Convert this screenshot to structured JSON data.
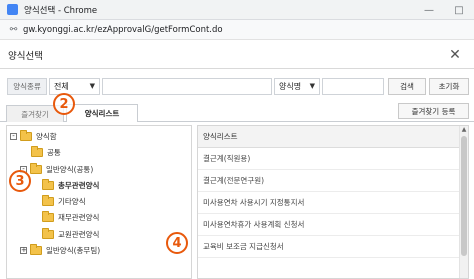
{
  "window": {
    "title": "양식선택 - Chrome",
    "url": "gw.kyonggi.ac.kr/ezApprovalG/getFormCont.do"
  },
  "dialog": {
    "title": "양식선택"
  },
  "search": {
    "form_type_label": "양식종류",
    "form_type_value": "전체",
    "form_name_label": "양식명",
    "form_name_value": "",
    "search_button": "검색",
    "reset_button": "초기화"
  },
  "tabs": [
    {
      "label": "즐겨찾기"
    },
    {
      "label": "양식리스트"
    }
  ],
  "favorite_button": "즐겨찾기 등록",
  "tree": [
    {
      "label": "양식함",
      "expander": "-"
    },
    {
      "label": "공통",
      "expander": ""
    },
    {
      "label": "일반양식(공통)",
      "expander": "-"
    },
    {
      "label": "총무관련양식",
      "expander": ""
    },
    {
      "label": "기타양식",
      "expander": ""
    },
    {
      "label": "재무관련양식",
      "expander": ""
    },
    {
      "label": "교원관련양식",
      "expander": ""
    },
    {
      "label": "일반양식(총무팀)",
      "expander": "+"
    }
  ],
  "list": {
    "header": "양식리스트",
    "items": [
      "결근계(직원용)",
      "결근계(전문연구원)",
      "미사용연차 사용시기 지정통지서",
      "미사용연차휴가 사용계획 신청서",
      "교육비 보조금 지급신청서"
    ]
  },
  "badges": {
    "b2": "2",
    "b3": "3",
    "b4": "4"
  },
  "colors": {
    "badge": "#e8590c",
    "folder": "#f3c24a"
  }
}
